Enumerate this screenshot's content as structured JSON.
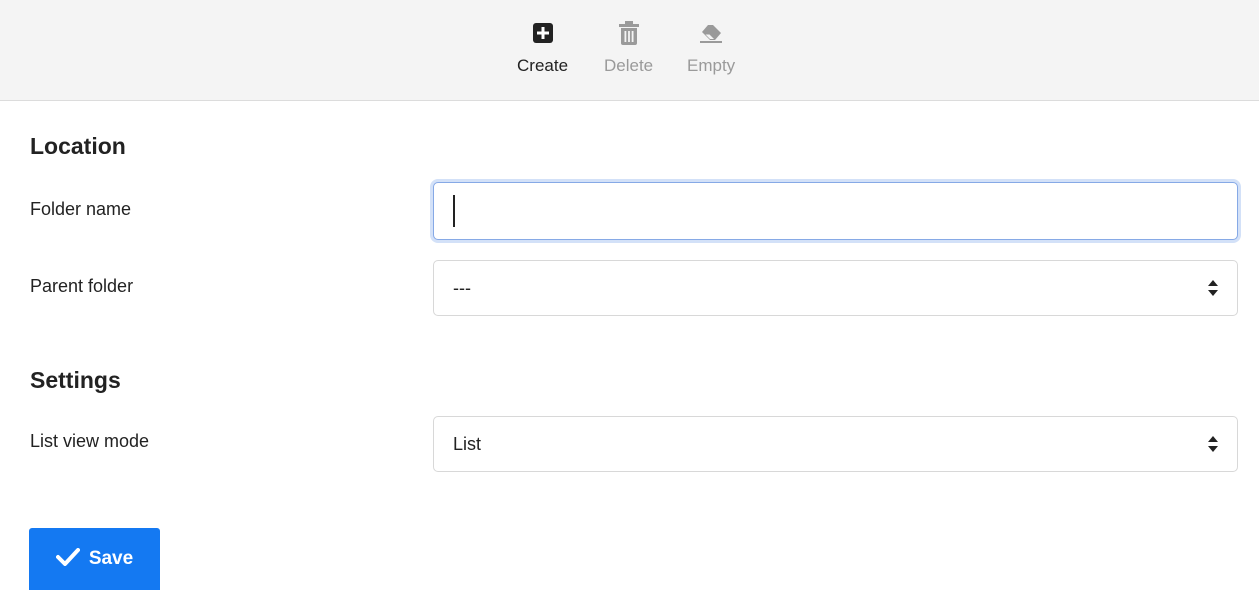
{
  "toolbar": {
    "create_label": "Create",
    "delete_label": "Delete",
    "empty_label": "Empty",
    "icons": {
      "create": "plus-square-icon",
      "delete": "trash-icon",
      "empty": "eraser-icon"
    }
  },
  "location": {
    "title": "Location",
    "folder_name_label": "Folder name",
    "folder_name_value": "",
    "parent_folder_label": "Parent folder",
    "parent_folder_value": "---"
  },
  "settings": {
    "title": "Settings",
    "list_view_mode_label": "List view mode",
    "list_view_mode_value": "List"
  },
  "actions": {
    "save_label": "Save"
  },
  "colors": {
    "accent": "#1479f2",
    "toolbar_bg": "#f4f4f4",
    "focus_border": "#86a9e6",
    "disabled_text": "#9a9a9a"
  }
}
